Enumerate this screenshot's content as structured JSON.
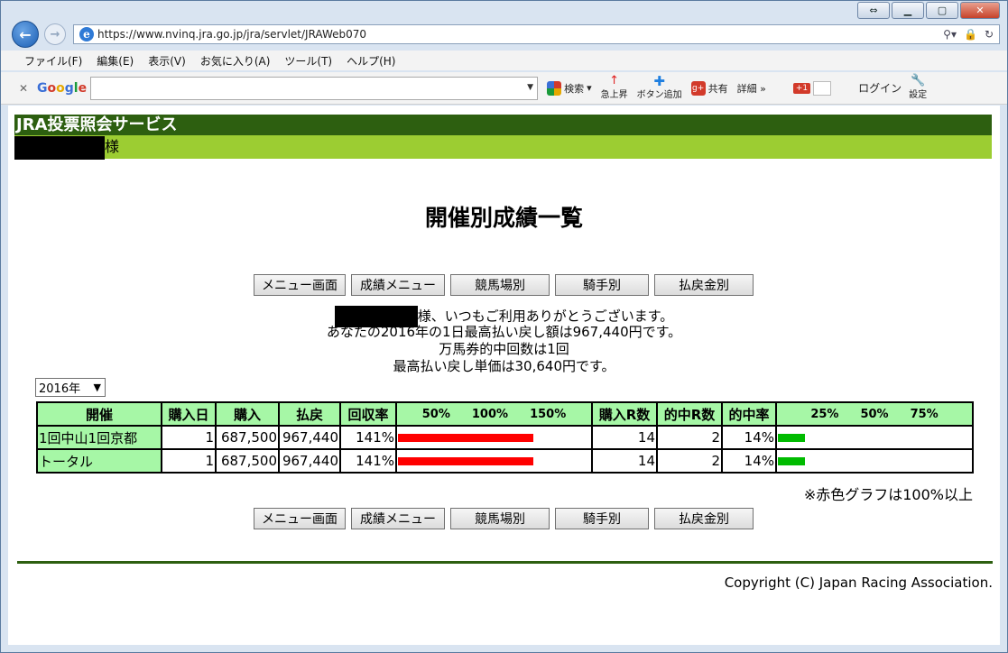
{
  "browser": {
    "url": "https://www.nvinq.jra.go.jp/jra/servlet/JRAWeb070",
    "menu": [
      "ファイル(F)",
      "編集(E)",
      "表示(V)",
      "お気に入り(A)",
      "ツール(T)",
      "ヘルプ(H)"
    ],
    "google_label": "Google",
    "search_label": "検索",
    "trend_label": "急上昇",
    "add_button_label": "ボタン追加",
    "share_label": "共有",
    "detail_label": "詳細 »",
    "gplus_label": "+1",
    "login_label": "ログイン",
    "settings_label": "設定"
  },
  "header": {
    "service_title": "JRA投票照会サービス",
    "user_suffix": "様"
  },
  "page": {
    "title": "開催別成績一覧",
    "buttons": [
      "メニュー画面",
      "成績メニュー",
      "競馬場別",
      "騎手別",
      "払戻金別"
    ],
    "greeting_suffix": "様、いつもご利用ありがとうございます。",
    "line2": "あなたの2016年の1日最高払い戻し額は967,440円です。",
    "line3": "万馬券的中回数は1回",
    "line4": "最高払い戻し単価は30,640円です。",
    "year_select": "2016年",
    "note": "※赤色グラフは100%以上",
    "copyright": "Copyright (C) Japan Racing Association."
  },
  "table": {
    "headers": [
      "開催",
      "購入日",
      "購入",
      "払戻",
      "回収率",
      "50%　100%　150%",
      "購入R数",
      "的中R数",
      "的中率",
      "25%　50%　75%"
    ],
    "scale1": [
      "50%",
      "100%",
      "150%"
    ],
    "scale2": [
      "25%",
      "50%",
      "75%"
    ],
    "rows": [
      {
        "label": "1回中山1回京都",
        "days": "1",
        "purchase": "687,500",
        "payout": "967,440",
        "return_rate": "141%",
        "races": "14",
        "hits": "2",
        "hit_rate": "14%",
        "return_value": 141,
        "hit_value": 14
      },
      {
        "label": "トータル",
        "days": "1",
        "purchase": "687,500",
        "payout": "967,440",
        "return_rate": "141%",
        "races": "14",
        "hits": "2",
        "hit_rate": "14%",
        "return_value": 141,
        "hit_value": 14
      }
    ]
  },
  "colors": {
    "header_dark": "#2d5f10",
    "header_light": "#9ccd32",
    "table_header": "#a6f7a6",
    "return_bar": "#ff0000",
    "hit_bar": "#00bb00"
  }
}
